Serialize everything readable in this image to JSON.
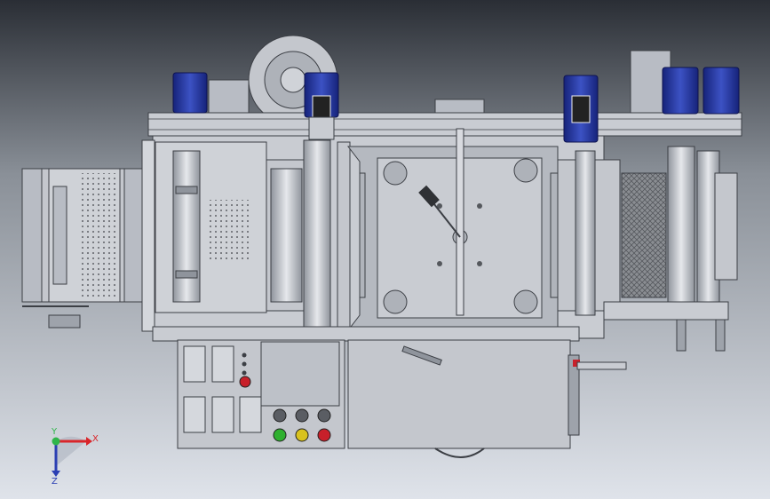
{
  "viewport": {
    "background_top": "#2a2e35",
    "background_bottom": "#dfe3ea"
  },
  "triad": {
    "x_label": "X",
    "y_label": "Y",
    "z_label": "Z",
    "x_color": "#d9252a",
    "y_color": "#2fb54a",
    "z_color": "#2b3fb3"
  },
  "model": {
    "frame_color": "#c9ccd2",
    "panel_color": "#b8bcc4",
    "edge_color": "#3c3f45",
    "motor_color": "#1f2f8f",
    "roller_color": "#9ea3ab",
    "mesh_color": "#7a7d82",
    "buttons": [
      {
        "name": "btn-gray-1",
        "color": "#5a5d63"
      },
      {
        "name": "btn-gray-2",
        "color": "#5a5d63"
      },
      {
        "name": "btn-gray-3",
        "color": "#5a5d63"
      },
      {
        "name": "btn-red-top",
        "color": "#c8202a"
      },
      {
        "name": "btn-green",
        "color": "#2fb02f"
      },
      {
        "name": "btn-yellow",
        "color": "#d8c21e"
      },
      {
        "name": "btn-red",
        "color": "#c8202a"
      }
    ]
  }
}
